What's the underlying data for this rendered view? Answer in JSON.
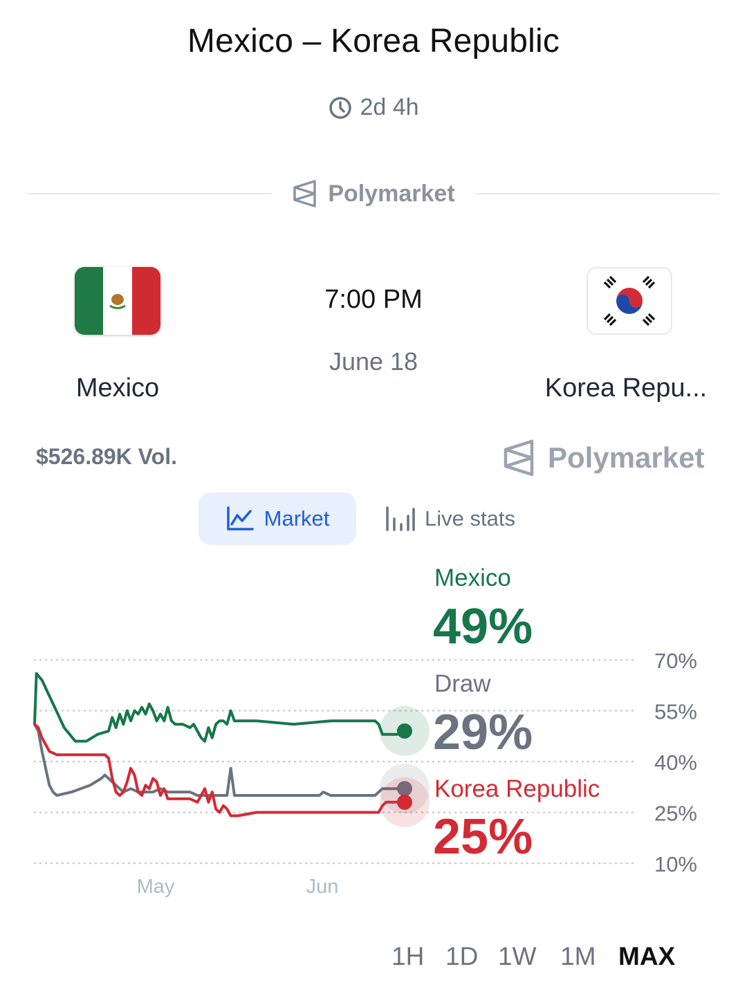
{
  "header": {
    "title": "Mexico – Korea Republic",
    "countdown": "2d 4h"
  },
  "source_brand": "Polymarket",
  "match": {
    "home_team": "Mexico",
    "away_team": "Korea Repu...",
    "kickoff_time": "7:00 PM",
    "kickoff_date": "June 18",
    "volume": "$526.89K Vol."
  },
  "tabs": [
    {
      "label": "Market",
      "icon": "line-chart-icon",
      "active": true
    },
    {
      "label": "Live stats",
      "icon": "bar-stats-icon",
      "active": false
    }
  ],
  "timeframes": [
    "1H",
    "1D",
    "1W",
    "1M",
    "MAX"
  ],
  "active_timeframe": "MAX",
  "colors": {
    "mexico": "#17774a",
    "draw": "#6b7280",
    "korea": "#d42a34",
    "accent": "#1f5fd6"
  },
  "chart_data": {
    "type": "line",
    "x_tick_labels": [
      "May",
      "Jun"
    ],
    "y_tick_labels": [
      "70%",
      "55%",
      "40%",
      "25%",
      "10%"
    ],
    "ylim": [
      10,
      70
    ],
    "grid": true,
    "x_domain": [
      0,
      100
    ],
    "series": [
      {
        "name": "Mexico",
        "label": "49%",
        "color": "#17774a",
        "points": [
          [
            0,
            51
          ],
          [
            0.5,
            66
          ],
          [
            2,
            64
          ],
          [
            5,
            57
          ],
          [
            8,
            50
          ],
          [
            11,
            46
          ],
          [
            14,
            46
          ],
          [
            17,
            48
          ],
          [
            20,
            49
          ],
          [
            21,
            53
          ],
          [
            22,
            50
          ],
          [
            23,
            54
          ],
          [
            24,
            51
          ],
          [
            25,
            55
          ],
          [
            26,
            52
          ],
          [
            27,
            55
          ],
          [
            28,
            54
          ],
          [
            29,
            56
          ],
          [
            30,
            54
          ],
          [
            31,
            57
          ],
          [
            32,
            55
          ],
          [
            33,
            52
          ],
          [
            34,
            54
          ],
          [
            35,
            52
          ],
          [
            36,
            56
          ],
          [
            37,
            52
          ],
          [
            38,
            51
          ],
          [
            40,
            51
          ],
          [
            42,
            50
          ],
          [
            43,
            51
          ],
          [
            44,
            49
          ],
          [
            45,
            47
          ],
          [
            46,
            46
          ],
          [
            47,
            50
          ],
          [
            48,
            47
          ],
          [
            49,
            51
          ],
          [
            50,
            52
          ],
          [
            51,
            52
          ],
          [
            52,
            51
          ],
          [
            53,
            55
          ],
          [
            54,
            52
          ],
          [
            55,
            52
          ],
          [
            60,
            52
          ],
          [
            70,
            51
          ],
          [
            80,
            52
          ],
          [
            90,
            52
          ],
          [
            92,
            52
          ],
          [
            93,
            51
          ],
          [
            94,
            48
          ],
          [
            96,
            48
          ],
          [
            98,
            48
          ],
          [
            100,
            49
          ]
        ]
      },
      {
        "name": "Draw",
        "label": "29%",
        "color": "#6b7280",
        "points": [
          [
            0,
            51
          ],
          [
            1,
            49
          ],
          [
            2,
            43
          ],
          [
            4,
            33
          ],
          [
            5,
            31
          ],
          [
            6,
            30
          ],
          [
            10,
            31
          ],
          [
            15,
            33
          ],
          [
            18,
            35
          ],
          [
            19,
            36
          ],
          [
            20,
            35
          ],
          [
            21,
            34
          ],
          [
            22,
            33
          ],
          [
            24,
            31
          ],
          [
            26,
            32
          ],
          [
            28,
            31
          ],
          [
            30,
            31
          ],
          [
            32,
            31
          ],
          [
            34,
            32
          ],
          [
            36,
            31
          ],
          [
            38,
            31
          ],
          [
            40,
            31
          ],
          [
            42,
            31
          ],
          [
            44,
            30
          ],
          [
            46,
            30
          ],
          [
            48,
            30
          ],
          [
            50,
            30
          ],
          [
            51,
            30
          ],
          [
            52,
            30
          ],
          [
            53,
            38
          ],
          [
            54,
            30
          ],
          [
            60,
            30
          ],
          [
            70,
            30
          ],
          [
            77,
            30
          ],
          [
            78,
            31
          ],
          [
            80,
            30
          ],
          [
            85,
            30
          ],
          [
            90,
            30
          ],
          [
            92,
            30
          ],
          [
            93,
            31
          ],
          [
            94,
            32
          ],
          [
            96,
            32
          ],
          [
            98,
            32
          ],
          [
            100,
            32
          ]
        ]
      },
      {
        "name": "Korea Republic",
        "label": "25%",
        "color": "#d42a34",
        "points": [
          [
            0,
            51
          ],
          [
            1,
            50
          ],
          [
            2,
            47
          ],
          [
            4,
            43
          ],
          [
            6,
            42
          ],
          [
            10,
            42
          ],
          [
            15,
            42
          ],
          [
            19,
            42
          ],
          [
            20,
            41
          ],
          [
            21,
            35
          ],
          [
            22,
            31
          ],
          [
            23,
            30
          ],
          [
            24,
            31
          ],
          [
            25,
            34
          ],
          [
            26,
            38
          ],
          [
            27,
            36
          ],
          [
            28,
            31
          ],
          [
            29,
            30
          ],
          [
            30,
            33
          ],
          [
            31,
            32
          ],
          [
            32,
            35
          ],
          [
            33,
            34
          ],
          [
            34,
            30
          ],
          [
            35,
            32
          ],
          [
            36,
            29
          ],
          [
            38,
            29
          ],
          [
            40,
            29
          ],
          [
            42,
            29
          ],
          [
            44,
            28
          ],
          [
            45,
            30
          ],
          [
            46,
            32
          ],
          [
            47,
            28
          ],
          [
            48,
            31
          ],
          [
            49,
            26
          ],
          [
            50,
            25
          ],
          [
            51,
            27
          ],
          [
            52,
            26
          ],
          [
            53,
            24
          ],
          [
            55,
            24
          ],
          [
            60,
            25
          ],
          [
            70,
            25
          ],
          [
            80,
            25
          ],
          [
            85,
            25
          ],
          [
            90,
            25
          ],
          [
            92,
            25
          ],
          [
            93,
            25
          ],
          [
            94,
            27
          ],
          [
            95,
            28
          ],
          [
            96,
            28
          ],
          [
            98,
            28
          ],
          [
            100,
            28
          ]
        ]
      }
    ]
  }
}
